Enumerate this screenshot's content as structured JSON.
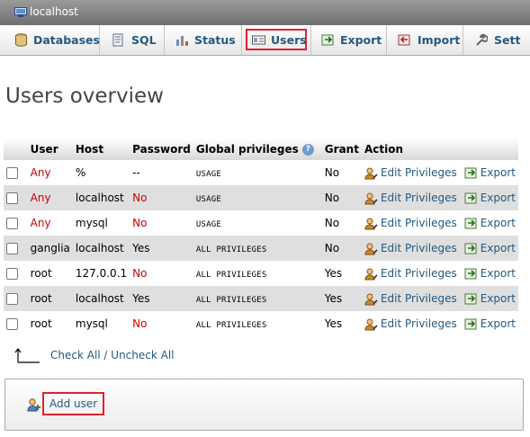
{
  "server": {
    "label": "localhost",
    "icon": "server-icon"
  },
  "tabs": [
    {
      "label": "Databases",
      "icon": "database-icon"
    },
    {
      "label": "SQL",
      "icon": "sql-icon"
    },
    {
      "label": "Status",
      "icon": "status-icon"
    },
    {
      "label": "Users",
      "icon": "users-icon",
      "active": true
    },
    {
      "label": "Export",
      "icon": "export-icon"
    },
    {
      "label": "Import",
      "icon": "import-icon"
    },
    {
      "label": "Sett",
      "icon": "wrench-icon"
    }
  ],
  "title": "Users overview",
  "table": {
    "headers": {
      "user": "User",
      "host": "Host",
      "password": "Password",
      "privileges": "Global privileges",
      "grant": "Grant",
      "action": "Action"
    },
    "help_icon": "?",
    "edit_label": "Edit Privileges",
    "export_label": "Export",
    "rows": [
      {
        "user": "Any",
        "host": "%",
        "password": "--",
        "privileges": "USAGE",
        "grant": "No"
      },
      {
        "user": "Any",
        "host": "localhost",
        "password": "No",
        "privileges": "USAGE",
        "grant": "No"
      },
      {
        "user": "Any",
        "host": "mysql",
        "password": "No",
        "privileges": "USAGE",
        "grant": "No"
      },
      {
        "user": "ganglia",
        "host": "localhost",
        "password": "Yes",
        "privileges": "ALL PRIVILEGES",
        "grant": "No"
      },
      {
        "user": "root",
        "host": "127.0.0.1",
        "password": "No",
        "privileges": "ALL PRIVILEGES",
        "grant": "Yes"
      },
      {
        "user": "root",
        "host": "localhost",
        "password": "Yes",
        "privileges": "ALL PRIVILEGES",
        "grant": "Yes"
      },
      {
        "user": "root",
        "host": "mysql",
        "password": "No",
        "privileges": "ALL PRIVILEGES",
        "grant": "Yes"
      }
    ]
  },
  "check_all": {
    "check": "Check All",
    "separator": " / ",
    "uncheck": "Uncheck All"
  },
  "add_user": {
    "label": "Add user",
    "icon": "add-user-icon"
  },
  "colors": {
    "link": "#235a81",
    "highlight": "#e0212d",
    "negative": "#cc0000",
    "row_alt": "#dfdfdf"
  }
}
